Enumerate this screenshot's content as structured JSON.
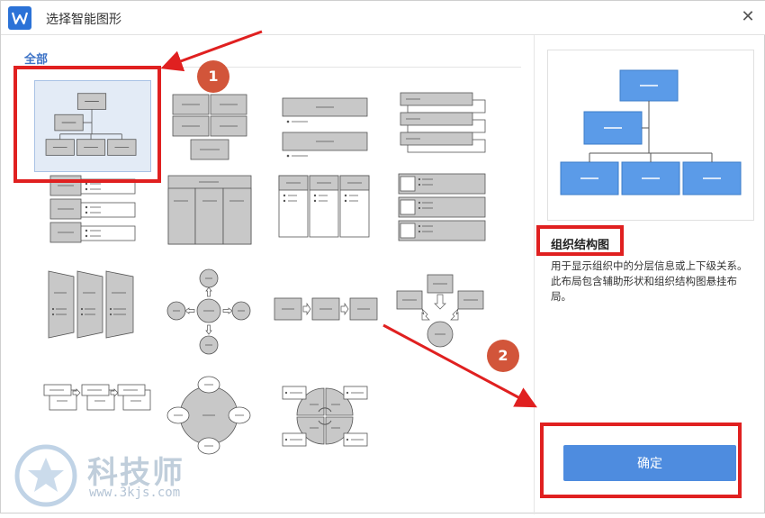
{
  "window": {
    "title": "选择智能图形",
    "close_glyph": "✕"
  },
  "category": {
    "active_tab": "全部"
  },
  "preview": {
    "layout_name": "组织结构图",
    "description": "用于显示组织中的分层信息或上下级关系。此布局包含辅助形状和组织结构图悬挂布局。"
  },
  "buttons": {
    "ok_label": "确定"
  },
  "annotations": {
    "step1": "1",
    "step2": "2"
  },
  "watermark": {
    "brand": "科技师",
    "url": "www.3kjs.com"
  },
  "colors": {
    "accent": "#4e8cdf",
    "annotation_red": "#e02020",
    "badge": "#d2553a",
    "selected_bg": "#e3ebf6"
  },
  "layouts": [
    {
      "id": "org-chart",
      "selected": true
    },
    {
      "id": "grid-boxes",
      "selected": false
    },
    {
      "id": "bullet-list-bars",
      "selected": false
    },
    {
      "id": "stacked-tabs",
      "selected": false
    },
    {
      "id": "labeled-list",
      "selected": false
    },
    {
      "id": "table-columns",
      "selected": false
    },
    {
      "id": "column-cards",
      "selected": false
    },
    {
      "id": "picture-list",
      "selected": false
    },
    {
      "id": "funnel-panels",
      "selected": false
    },
    {
      "id": "radial-cross",
      "selected": false
    },
    {
      "id": "process-arrows",
      "selected": false
    },
    {
      "id": "converging-arrows",
      "selected": false
    },
    {
      "id": "step-cards",
      "selected": false
    },
    {
      "id": "circle-hub",
      "selected": false
    },
    {
      "id": "cycle-quadrants",
      "selected": false
    }
  ]
}
